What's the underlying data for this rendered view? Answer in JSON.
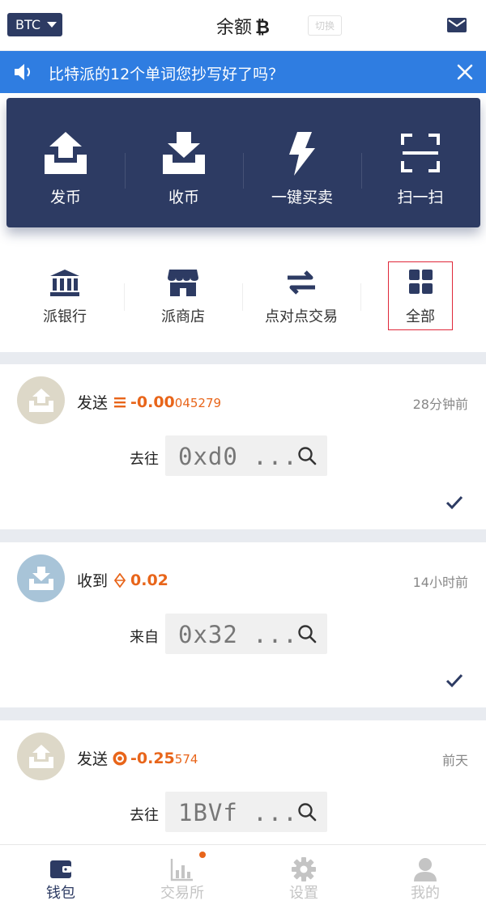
{
  "header": {
    "coin_selector": "BTC",
    "title": "余额",
    "title_symbol": "₿",
    "switch_label": "切换",
    "mail_icon": "mail-icon"
  },
  "banner": {
    "message": "比特派的12个单词您抄写好了吗？",
    "icons": [
      "speaker-icon",
      "close-icon"
    ],
    "color": "#2f7de1"
  },
  "actions": [
    {
      "label": "发币",
      "icon": "send-tray-icon"
    },
    {
      "label": "收币",
      "icon": "receive-tray-icon"
    },
    {
      "label": "一键买卖",
      "icon": "lightning-icon"
    },
    {
      "label": "扫一扫",
      "icon": "scan-icon"
    }
  ],
  "shortcuts": [
    {
      "label": "派银行",
      "icon": "bank-icon"
    },
    {
      "label": "派商店",
      "icon": "store-icon"
    },
    {
      "label": "点对点交易",
      "icon": "exchange-arrows-icon"
    },
    {
      "label": "全部",
      "icon": "grid-icon"
    }
  ],
  "transactions": [
    {
      "action": "发送",
      "coin_icon": "eth-icon",
      "amount_main": "-0.00",
      "amount_sub": "045279",
      "time": "28分钟前",
      "direction": "去往",
      "address": "0xd0 ...",
      "status": "confirmed"
    },
    {
      "action": "收到",
      "coin_icon": "etc-diamond-icon",
      "amount_main": "0.02",
      "amount_sub": "",
      "time": "14小时前",
      "direction": "来自",
      "address": "0x32 ...",
      "status": "confirmed"
    },
    {
      "action": "发送",
      "coin_icon": "btc-circle-icon",
      "amount_main": "-0.25",
      "amount_sub": "574",
      "time": "前天",
      "direction": "去往",
      "address": "1BVf ...",
      "status": ""
    }
  ],
  "bottom_nav": [
    {
      "label": "钱包",
      "icon": "wallet-icon",
      "active": true
    },
    {
      "label": "交易所",
      "icon": "exchange-chart-icon",
      "active": false,
      "has_badge": true
    },
    {
      "label": "设置",
      "icon": "gear-icon",
      "active": false
    },
    {
      "label": "我的",
      "icon": "user-icon",
      "active": false
    }
  ],
  "colors": {
    "primary": "#2d3b63",
    "accent": "#e8651a",
    "banner": "#2f7de1"
  }
}
